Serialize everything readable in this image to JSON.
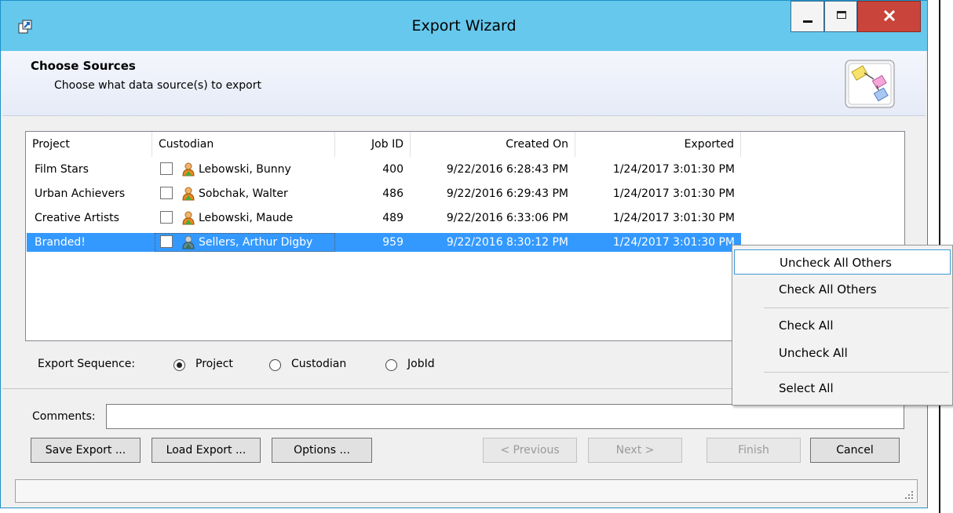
{
  "window": {
    "title": "Export Wizard"
  },
  "header": {
    "title": "Choose Sources",
    "subtitle": "Choose what data source(s) to export"
  },
  "list": {
    "columns": [
      "Project",
      "Custodian",
      "Job ID",
      "Created On",
      "Exported"
    ],
    "rows": [
      {
        "project": "Film Stars",
        "custodian": "Lebowski, Bunny",
        "job_id": "400",
        "created_on": "9/22/2016 6:28:43 PM",
        "exported": "1/24/2017 3:01:30 PM"
      },
      {
        "project": "Urban Achievers",
        "custodian": "Sobchak, Walter",
        "job_id": "486",
        "created_on": "9/22/2016 6:29:43 PM",
        "exported": "1/24/2017 3:01:30 PM"
      },
      {
        "project": "Creative Artists",
        "custodian": "Lebowski, Maude",
        "job_id": "489",
        "created_on": "9/22/2016 6:33:06 PM",
        "exported": "1/24/2017 3:01:30 PM"
      },
      {
        "project": "Branded!",
        "custodian": "Sellers, Arthur Digby",
        "job_id": "959",
        "created_on": "9/22/2016 8:30:12 PM",
        "exported": "1/24/2017 3:01:30 PM"
      }
    ],
    "selected_row": 3
  },
  "export_sequence": {
    "label": "Export Sequence:",
    "options": [
      "Project",
      "Custodian",
      "JobId"
    ],
    "selected": "Project"
  },
  "comments": {
    "label": "Comments:",
    "value": ""
  },
  "buttons": {
    "save_export": "Save Export ...",
    "load_export": "Load Export ...",
    "options": "Options ...",
    "previous": "< Previous",
    "next": "Next >",
    "finish": "Finish",
    "cancel": "Cancel"
  },
  "context_menu": {
    "items": [
      "Uncheck All Others",
      "Check All Others",
      "Check All",
      "Uncheck All",
      "Select All"
    ],
    "highlighted": "Uncheck All Others"
  },
  "colors": {
    "titlebar": "#66c8ec",
    "selection": "#3399ff",
    "close_button": "#c9443a"
  }
}
